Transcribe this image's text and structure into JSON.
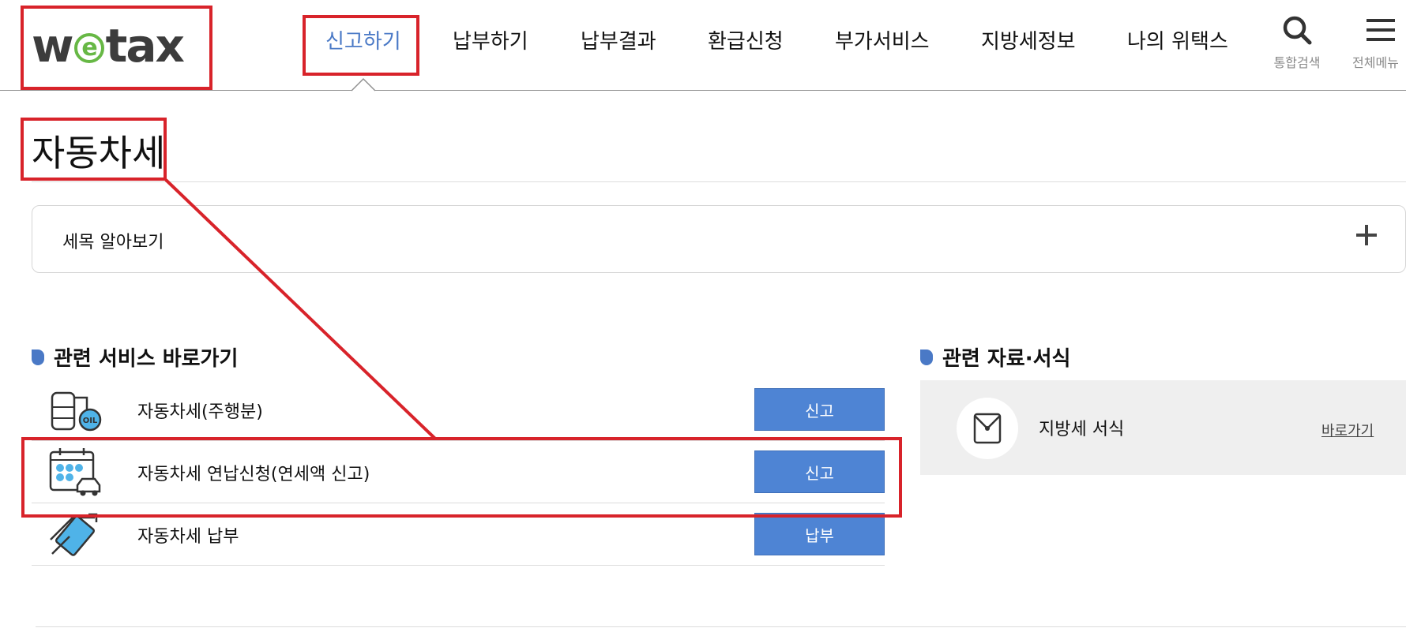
{
  "header": {
    "logo_text_left": "w",
    "logo_text_e": "e",
    "logo_text_right": "tax",
    "nav": [
      {
        "label": "신고하기",
        "active": true
      },
      {
        "label": "납부하기",
        "active": false
      },
      {
        "label": "납부결과",
        "active": false
      },
      {
        "label": "환급신청",
        "active": false
      },
      {
        "label": "부가서비스",
        "active": false
      },
      {
        "label": "지방세정보",
        "active": false
      },
      {
        "label": "나의 위택스",
        "active": false
      }
    ],
    "search_label": "통합검색",
    "menu_label": "전체메뉴"
  },
  "page": {
    "title": "자동차세"
  },
  "accordion": {
    "label": "세목 알아보기"
  },
  "services": {
    "heading": "관련 서비스 바로가기",
    "items": [
      {
        "label": "자동차세(주행분)",
        "button": "신고",
        "icon": "oil-tank-icon"
      },
      {
        "label": "자동차세 연납신청(연세액 신고)",
        "button": "신고",
        "icon": "calendar-car-icon"
      },
      {
        "label": "자동차세 납부",
        "button": "납부",
        "icon": "card-payment-icon"
      }
    ]
  },
  "documents": {
    "heading": "관련 자료·서식",
    "item_label": "지방세 서식",
    "link": "바로가기",
    "icon": "envelope-icon"
  },
  "colors": {
    "accent": "#4a79c6",
    "button": "#4e84d4",
    "annotation": "#d8232a",
    "logo_green": "#67b845"
  }
}
